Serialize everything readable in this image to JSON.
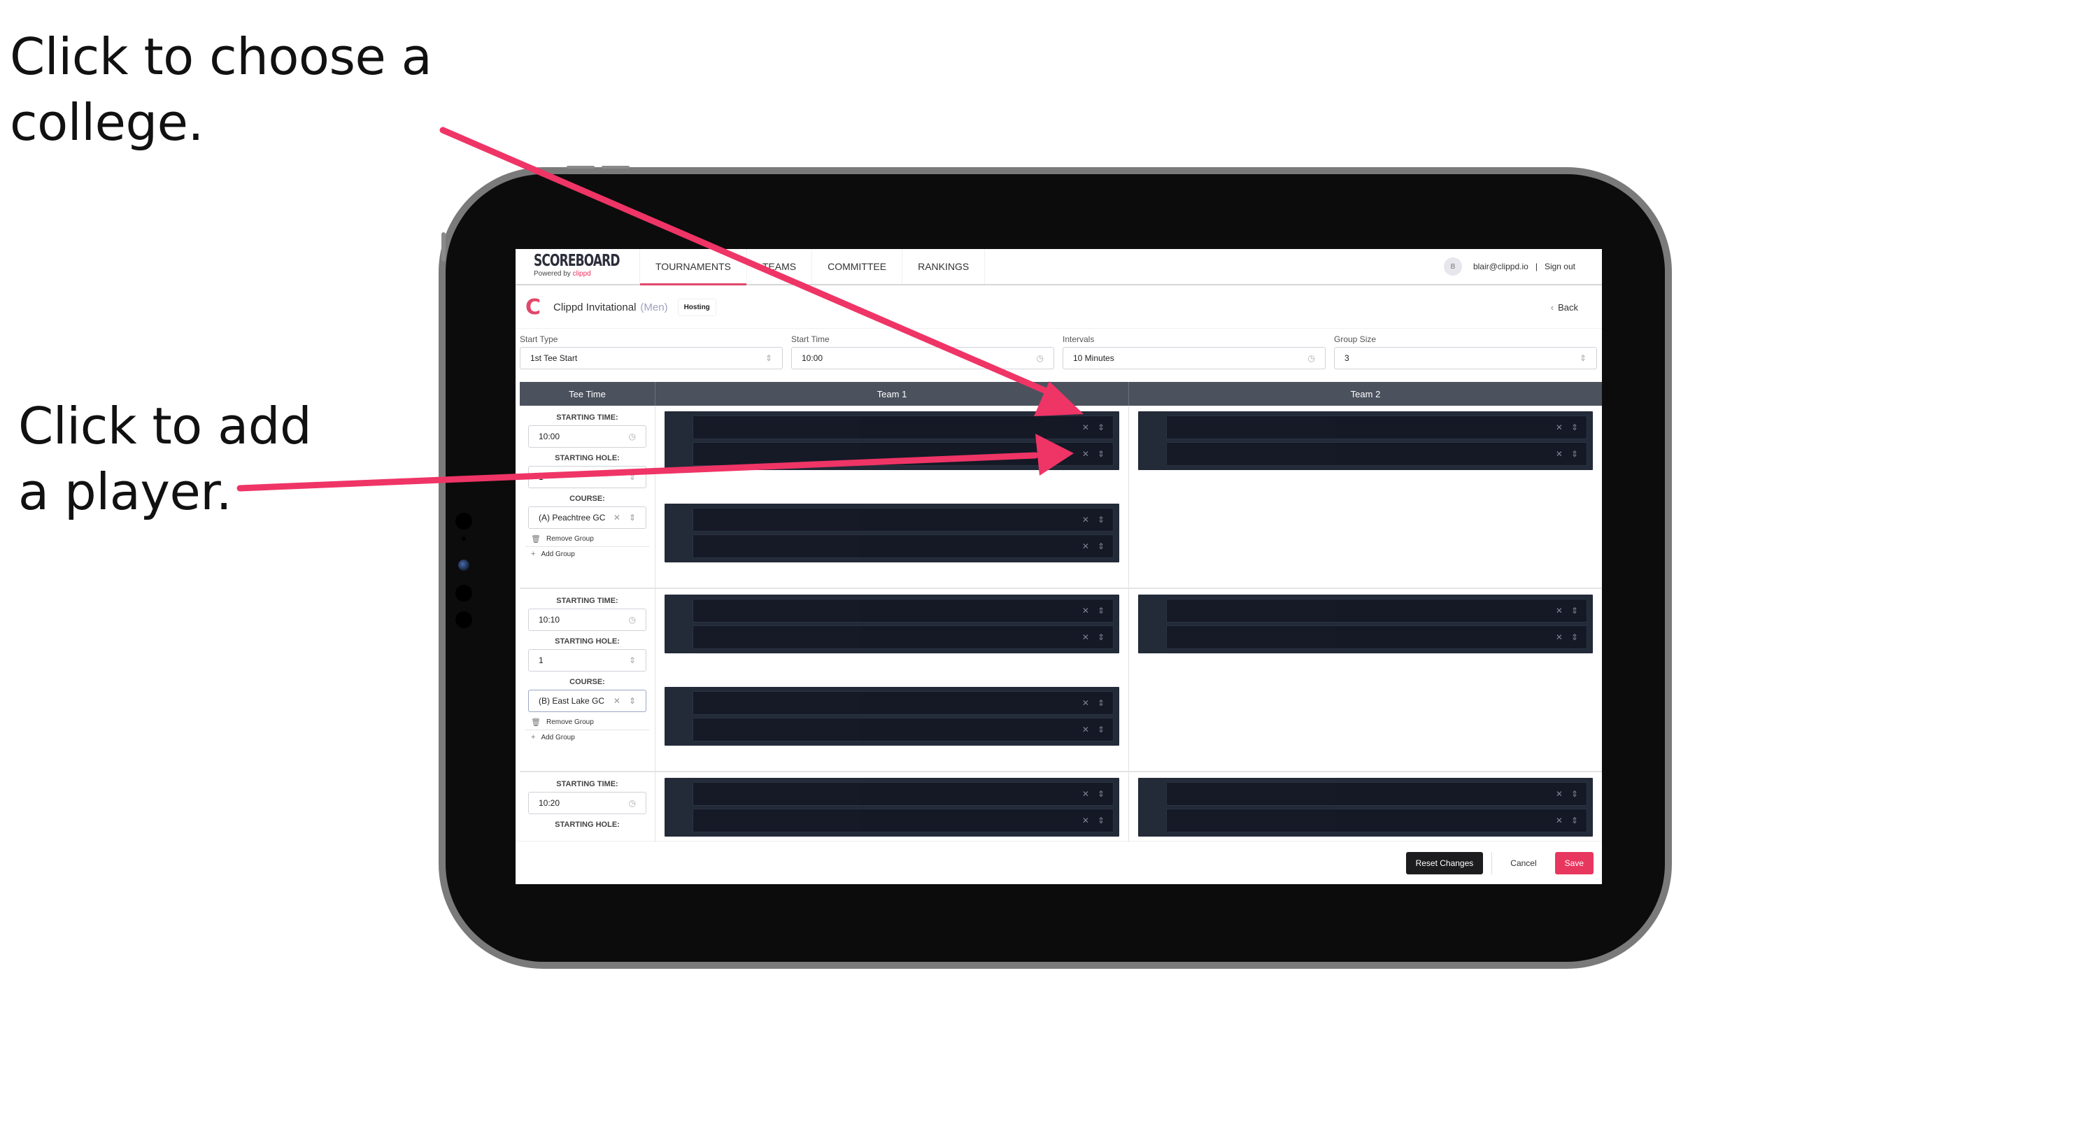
{
  "annotations": {
    "college_line1": "Click to choose a",
    "college_line2": "college.",
    "player_line1": "Click to add",
    "player_line2": "a player.",
    "arrow_color": "#ef3466"
  },
  "app": {
    "brand_title": "SCOREBOARD",
    "brand_powered": "Powered by",
    "brand_name": "clippd",
    "nav": [
      {
        "label": "TOURNAMENTS",
        "active": true
      },
      {
        "label": "TEAMS",
        "active": false
      },
      {
        "label": "COMMITTEE",
        "active": false
      },
      {
        "label": "RANKINGS",
        "active": false
      }
    ],
    "user_avatar_initial": "B",
    "user_email": "blair@clippd.io",
    "separator": "|",
    "sign_out": "Sign out"
  },
  "event": {
    "logo_letter": "C",
    "title": "Clippd Invitational",
    "division": "(Men)",
    "badge": "Hosting",
    "back_label": "Back"
  },
  "settings": {
    "start_type": {
      "label": "Start Type",
      "value": "1st Tee Start"
    },
    "start_time": {
      "label": "Start Time",
      "value": "10:00"
    },
    "intervals": {
      "label": "Intervals",
      "value": "10 Minutes"
    },
    "group_size": {
      "label": "Group Size",
      "value": "3"
    }
  },
  "grid": {
    "headers": {
      "tee_time": "Tee Time",
      "team1": "Team 1",
      "team2": "Team 2"
    },
    "labels": {
      "starting_time": "STARTING TIME:",
      "starting_hole": "STARTING HOLE:",
      "course": "COURSE:",
      "remove_group": "Remove Group",
      "add_group": "Add Group"
    },
    "groups": [
      {
        "starting_time": "10:00",
        "starting_hole": "1",
        "course": "(A) Peachtree GC"
      },
      {
        "starting_time": "10:10",
        "starting_hole": "1",
        "course": "(B) East Lake GC"
      },
      {
        "starting_time": "10:20"
      }
    ],
    "clear_glyph": "✕",
    "sort_glyph": "⇕"
  },
  "footer": {
    "reset": "Reset Changes",
    "cancel": "Cancel",
    "save": "Save"
  },
  "colors": {
    "accent": "#e8375f",
    "header_bg": "#4b515d",
    "slot_bg": "#232a38",
    "player_row_bg": "#141925"
  }
}
